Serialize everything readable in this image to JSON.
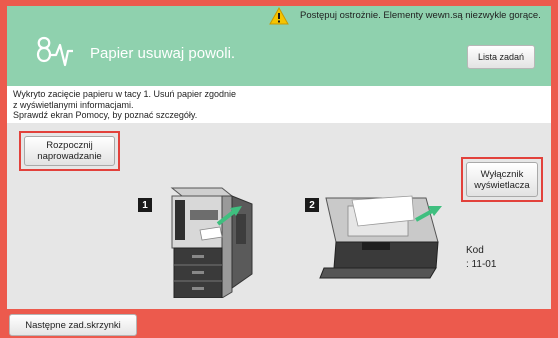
{
  "header": {
    "title": "Papier usuwaj powoli.",
    "jobs_button": "Lista zadań"
  },
  "warning": {
    "text": "Postępuj ostrożnie. Elementy wewn.są niezwykle gorące."
  },
  "message": {
    "lines": [
      "Wykryto zacięcie papieru w tacy 1. Usuń papier zgodnie",
      "z wyświetlanymi informacjami.",
      "Sprawdź ekran Pomocy, by poznać szczegóły."
    ]
  },
  "guidance_button": {
    "line1": "Rozpocznij",
    "line2": "naprowadzanie"
  },
  "display_switch_button": {
    "line1": "Wyłącznik",
    "line2": "wyświetlacza"
  },
  "steps": [
    "1",
    "2"
  ],
  "code": {
    "label": "Kod",
    "value": ": 11-01"
  },
  "footer": {
    "next_button": "Następne zad.skrzynki"
  },
  "colors": {
    "frame": "#ec5a4d",
    "header": "#8fd1ae",
    "highlight": "#e2413b",
    "warning": "#f5c400"
  },
  "icons": {
    "logo": "waveform-logo-icon",
    "warning": "warning-triangle-icon"
  }
}
